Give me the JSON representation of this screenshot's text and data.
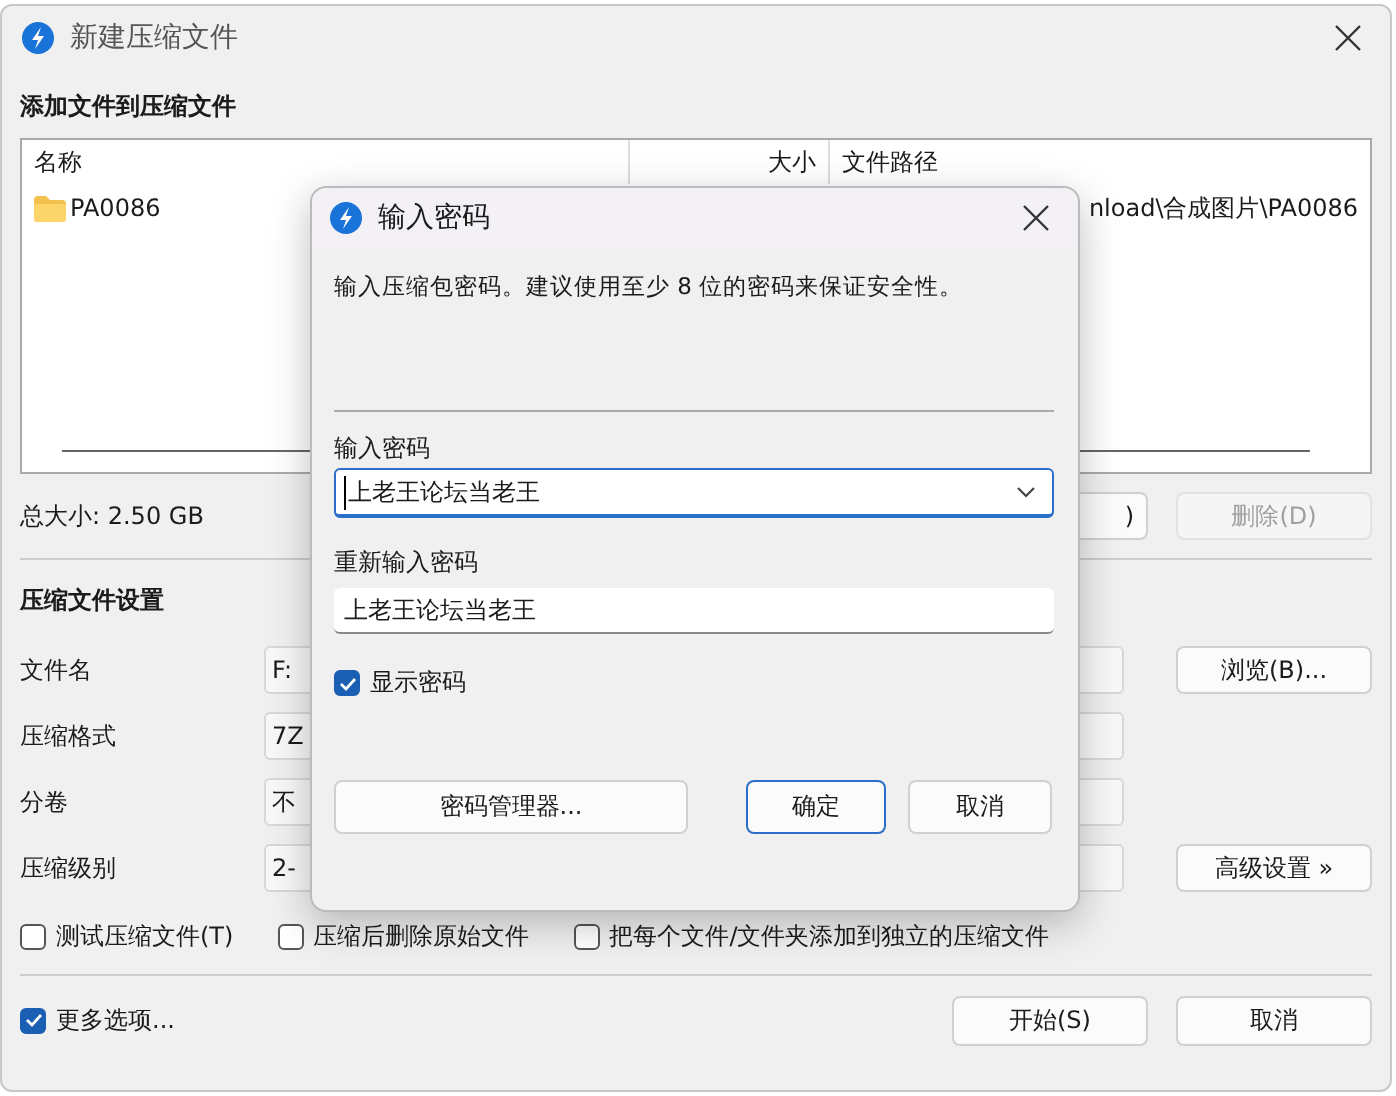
{
  "window": {
    "title": "新建压缩文件"
  },
  "files_section": {
    "heading": "添加文件到压缩文件",
    "columns": [
      "名称",
      "大小",
      "文件路径"
    ],
    "rows": [
      {
        "name": "PA0086",
        "path": "nload\\合成图片\\PA0086"
      }
    ],
    "total": "总大小: 2.50 GB",
    "buttons": [
      {
        "label": ")",
        "disabled": false
      },
      {
        "label": "删除(D)",
        "disabled": true
      }
    ]
  },
  "settings": {
    "heading": "压缩文件设置",
    "rows": [
      {
        "label": "文件名",
        "value": "F:",
        "button": "浏览(B)..."
      },
      {
        "label": "压缩格式",
        "value": "7Z"
      },
      {
        "label": "分卷",
        "value": "不"
      },
      {
        "label": "压缩级别",
        "value": "2-",
        "button": "高级设置 »"
      }
    ],
    "options": [
      {
        "label": "测试压缩文件(T)",
        "checked": false
      },
      {
        "label": "压缩后删除原始文件",
        "checked": false
      },
      {
        "label": "把每个文件/文件夹添加到独立的压缩文件",
        "checked": false
      }
    ]
  },
  "footer": {
    "more_options": {
      "label": "更多选项...",
      "checked": true
    },
    "buttons": [
      "开始(S)",
      "取消"
    ]
  },
  "dialog": {
    "title": "输入密码",
    "description": "输入压缩包密码。建议使用至少 8 位的密码来保证安全性。",
    "password_label": "输入密码",
    "password_value": "上老王论坛当老王",
    "confirm_label": "重新输入密码",
    "confirm_value": "上老王论坛当老王",
    "show_password": {
      "label": "显示密码",
      "checked": true
    },
    "buttons": [
      {
        "label": "密码管理器...",
        "kind": "wide"
      },
      {
        "label": "确定",
        "kind": "default"
      },
      {
        "label": "取消",
        "kind": "normal"
      }
    ]
  }
}
